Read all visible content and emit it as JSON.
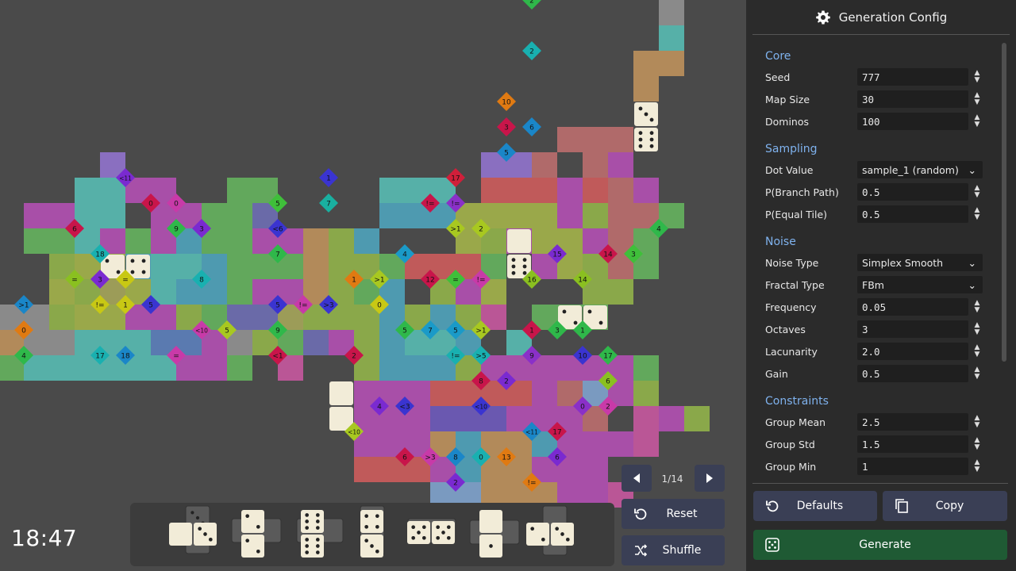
{
  "clock": "18:47",
  "pager": {
    "current": 1,
    "total": 14,
    "text": "1/14"
  },
  "actions": {
    "reset": "Reset",
    "shuffle": "Shuffle"
  },
  "panel": {
    "title": "Generation Config",
    "sections": {
      "core": "Core",
      "sampling": "Sampling",
      "noise": "Noise",
      "constraints": "Constraints"
    },
    "fields": {
      "seed": {
        "label": "Seed",
        "value": "777"
      },
      "map_size": {
        "label": "Map Size",
        "value": "30"
      },
      "dominos": {
        "label": "Dominos",
        "value": "100"
      },
      "dot_value": {
        "label": "Dot Value",
        "value": "sample_1 (random)"
      },
      "p_branch": {
        "label": "P(Branch Path)",
        "value": "0.5"
      },
      "p_equal": {
        "label": "P(Equal Tile)",
        "value": "0.5"
      },
      "noise_type": {
        "label": "Noise Type",
        "value": "Simplex Smooth"
      },
      "fractal_type": {
        "label": "Fractal Type",
        "value": "FBm"
      },
      "frequency": {
        "label": "Frequency",
        "value": "0.05"
      },
      "octaves": {
        "label": "Octaves",
        "value": "3"
      },
      "lacunarity": {
        "label": "Lacunarity",
        "value": "2.0"
      },
      "gain": {
        "label": "Gain",
        "value": "0.5"
      },
      "group_mean": {
        "label": "Group Mean",
        "value": "2.5"
      },
      "group_std": {
        "label": "Group Std",
        "value": "1.5"
      },
      "group_min": {
        "label": "Group Min",
        "value": "1"
      }
    },
    "footer": {
      "defaults": "Defaults",
      "copy": "Copy",
      "generate": "Generate"
    }
  },
  "colors": {
    "board_bg": "#4a4a4a",
    "panel_bg": "#2b2b2b",
    "button_bg": "#3a3f55",
    "generate_bg": "#1f5a34",
    "section_text": "#7fb2ee"
  },
  "board": {
    "region_colors": {
      "a": "#6a58b0",
      "b": "#a84fa8",
      "c": "#56b0a8",
      "d": "#ba5696",
      "e": "#62a85c",
      "f": "#8a6fc0",
      "g": "#9aa84a",
      "h": "#b28a5a",
      "i": "#c05a5a",
      "j": "#4e9ab0",
      "k": "#8aa84a",
      "l": "#5a7ab0",
      "m": "#4e8e4e",
      "n": "#8a8a8a",
      "o": "#6a6aa8",
      "p": "#7a9ac0",
      "q": "#b06a6a",
      "r": "#9c9c58"
    },
    "constraints": [
      {
        "c": 20,
        "r": -1,
        "t": "2",
        "color": "#2fb84a"
      },
      {
        "c": 20,
        "r": 1,
        "t": "2",
        "color": "#19b0b0"
      },
      {
        "c": 19,
        "r": 3,
        "t": "10",
        "color": "#e07a12"
      },
      {
        "c": 19,
        "r": 4,
        "t": "3",
        "color": "#c8154a"
      },
      {
        "c": 20,
        "r": 4,
        "t": "6",
        "color": "#1a86c8"
      },
      {
        "c": 19,
        "r": 5,
        "t": "5",
        "color": "#1a86c8"
      },
      {
        "c": 17,
        "r": 6,
        "t": "17",
        "color": "#d01f3a"
      },
      {
        "c": 4,
        "r": 6,
        "t": "<11",
        "color": "#7a2ad0"
      },
      {
        "c": 12,
        "r": 6,
        "t": "1",
        "color": "#3a34d0"
      },
      {
        "c": 5,
        "r": 7,
        "t": "0",
        "color": "#c8154a"
      },
      {
        "c": 6,
        "r": 7,
        "t": "0",
        "color": "#c83aa8"
      },
      {
        "c": 10,
        "r": 7,
        "t": "5",
        "color": "#3fbf3a"
      },
      {
        "c": 16,
        "r": 7,
        "t": "!=",
        "color": "#c8154a"
      },
      {
        "c": 12,
        "r": 7,
        "t": "7",
        "color": "#19b0a0"
      },
      {
        "c": 17,
        "r": 7,
        "t": "!=",
        "color": "#8a30c8"
      },
      {
        "c": 2,
        "r": 8,
        "t": "6",
        "color": "#c8154a"
      },
      {
        "c": 6,
        "r": 8,
        "t": "9",
        "color": "#2fb84a"
      },
      {
        "c": 7,
        "r": 8,
        "t": "3",
        "color": "#7a2ad0"
      },
      {
        "c": 10,
        "r": 8,
        "t": "<6",
        "color": "#3a34d0"
      },
      {
        "c": 17,
        "r": 8,
        "t": ">1",
        "color": "#a8c820"
      },
      {
        "c": 18,
        "r": 8,
        "t": "2",
        "color": "#a8c820"
      },
      {
        "c": 25,
        "r": 8,
        "t": "4",
        "color": "#2fb84a"
      },
      {
        "c": 3,
        "r": 9,
        "t": "18",
        "color": "#19b0b0"
      },
      {
        "c": 10,
        "r": 9,
        "t": "7",
        "color": "#2fb84a"
      },
      {
        "c": 15,
        "r": 9,
        "t": "4",
        "color": "#1a9ac8"
      },
      {
        "c": 21,
        "r": 9,
        "t": "15",
        "color": "#7a2ad0"
      },
      {
        "c": 23,
        "r": 9,
        "t": "14",
        "color": "#c8154a"
      },
      {
        "c": 24,
        "r": 9,
        "t": "3",
        "color": "#3fbf3a"
      },
      {
        "c": 2,
        "r": 10,
        "t": "=",
        "color": "#8ac020"
      },
      {
        "c": 3,
        "r": 10,
        "t": "3",
        "color": "#7a2ad0"
      },
      {
        "c": 4,
        "r": 10,
        "t": "=",
        "color": "#c8c814"
      },
      {
        "c": 7,
        "r": 10,
        "t": "8",
        "color": "#19b0b0"
      },
      {
        "c": 13,
        "r": 10,
        "t": "1",
        "color": "#e07a12"
      },
      {
        "c": 14,
        "r": 10,
        "t": ">1",
        "color": "#a8c820"
      },
      {
        "c": 16,
        "r": 10,
        "t": "12",
        "color": "#c8154a"
      },
      {
        "c": 17,
        "r": 10,
        "t": "=",
        "color": "#3fbf3a"
      },
      {
        "c": 18,
        "r": 10,
        "t": "!=",
        "color": "#c83aa8"
      },
      {
        "c": 20,
        "r": 10,
        "t": "16",
        "color": "#8ac020"
      },
      {
        "c": 22,
        "r": 10,
        "t": "14",
        "color": "#8ac020"
      },
      {
        "c": 0,
        "r": 11,
        "t": ">1",
        "color": "#1a86c8"
      },
      {
        "c": 3,
        "r": 11,
        "t": "!=",
        "color": "#c8c814"
      },
      {
        "c": 4,
        "r": 11,
        "t": "1",
        "color": "#c8c814"
      },
      {
        "c": 5,
        "r": 11,
        "t": "5",
        "color": "#3a34d0"
      },
      {
        "c": 10,
        "r": 11,
        "t": "5",
        "color": "#3a34d0"
      },
      {
        "c": 11,
        "r": 11,
        "t": "!=",
        "color": "#c83aa8"
      },
      {
        "c": 12,
        "r": 11,
        "t": ">3",
        "color": "#3a34d0"
      },
      {
        "c": 14,
        "r": 11,
        "t": "0",
        "color": "#c8c814"
      },
      {
        "c": 0,
        "r": 12,
        "t": "0",
        "color": "#e07a12"
      },
      {
        "c": 7,
        "r": 12,
        "t": "<10",
        "color": "#c83aa8"
      },
      {
        "c": 8,
        "r": 12,
        "t": "5",
        "color": "#a8c820"
      },
      {
        "c": 10,
        "r": 12,
        "t": "9",
        "color": "#2fb84a"
      },
      {
        "c": 15,
        "r": 12,
        "t": "5",
        "color": "#2fb84a"
      },
      {
        "c": 16,
        "r": 12,
        "t": "7",
        "color": "#1a9ac8"
      },
      {
        "c": 17,
        "r": 12,
        "t": "5",
        "color": "#1a9ac8"
      },
      {
        "c": 18,
        "r": 12,
        "t": ">1",
        "color": "#a8c820"
      },
      {
        "c": 20,
        "r": 12,
        "t": "1",
        "color": "#c8154a"
      },
      {
        "c": 21,
        "r": 12,
        "t": "3",
        "color": "#2fb84a"
      },
      {
        "c": 22,
        "r": 12,
        "t": "1",
        "color": "#2fb84a"
      },
      {
        "c": 0,
        "r": 13,
        "t": "4",
        "color": "#2fb84a"
      },
      {
        "c": 3,
        "r": 13,
        "t": "17",
        "color": "#19b0b0"
      },
      {
        "c": 4,
        "r": 13,
        "t": "18",
        "color": "#1a86c8"
      },
      {
        "c": 6,
        "r": 13,
        "t": "=",
        "color": "#c83aa8"
      },
      {
        "c": 10,
        "r": 13,
        "t": "<1",
        "color": "#c8154a"
      },
      {
        "c": 13,
        "r": 13,
        "t": "2",
        "color": "#c8154a"
      },
      {
        "c": 17,
        "r": 13,
        "t": "!=",
        "color": "#19b0b0"
      },
      {
        "c": 18,
        "r": 13,
        "t": ">5",
        "color": "#19b0b0"
      },
      {
        "c": 20,
        "r": 13,
        "t": "9",
        "color": "#8a30c8"
      },
      {
        "c": 22,
        "r": 13,
        "t": "10",
        "color": "#3a34d0"
      },
      {
        "c": 23,
        "r": 13,
        "t": "17",
        "color": "#2fb84a"
      },
      {
        "c": 23,
        "r": 14,
        "t": "6",
        "color": "#8ac020"
      },
      {
        "c": 18,
        "r": 14,
        "t": "8",
        "color": "#c8154a"
      },
      {
        "c": 19,
        "r": 14,
        "t": "2",
        "color": "#7a2ad0"
      },
      {
        "c": 14,
        "r": 15,
        "t": "4",
        "color": "#7a2ad0"
      },
      {
        "c": 15,
        "r": 15,
        "t": "<3",
        "color": "#3a34d0"
      },
      {
        "c": 18,
        "r": 15,
        "t": "<10",
        "color": "#3a34d0"
      },
      {
        "c": 22,
        "r": 15,
        "t": "0",
        "color": "#8a30c8"
      },
      {
        "c": 23,
        "r": 15,
        "t": "2",
        "color": "#c83aa8"
      },
      {
        "c": 13,
        "r": 16,
        "t": "<10",
        "color": "#a8c820"
      },
      {
        "c": 20,
        "r": 16,
        "t": "<11",
        "color": "#1a86c8"
      },
      {
        "c": 21,
        "r": 16,
        "t": "17",
        "color": "#c8154a"
      },
      {
        "c": 15,
        "r": 17,
        "t": "6",
        "color": "#c8154a"
      },
      {
        "c": 16,
        "r": 17,
        "t": ">3",
        "color": "#c83aa8"
      },
      {
        "c": 17,
        "r": 17,
        "t": "8",
        "color": "#1a86c8"
      },
      {
        "c": 18,
        "r": 17,
        "t": "0",
        "color": "#19b0b0"
      },
      {
        "c": 19,
        "r": 17,
        "t": "13",
        "color": "#e07a12"
      },
      {
        "c": 21,
        "r": 17,
        "t": "6",
        "color": "#7a2ad0"
      },
      {
        "c": 17,
        "r": 18,
        "t": "2",
        "color": "#7a2ad0"
      },
      {
        "c": 20,
        "r": 18,
        "t": "!=",
        "color": "#e07a12"
      }
    ]
  }
}
